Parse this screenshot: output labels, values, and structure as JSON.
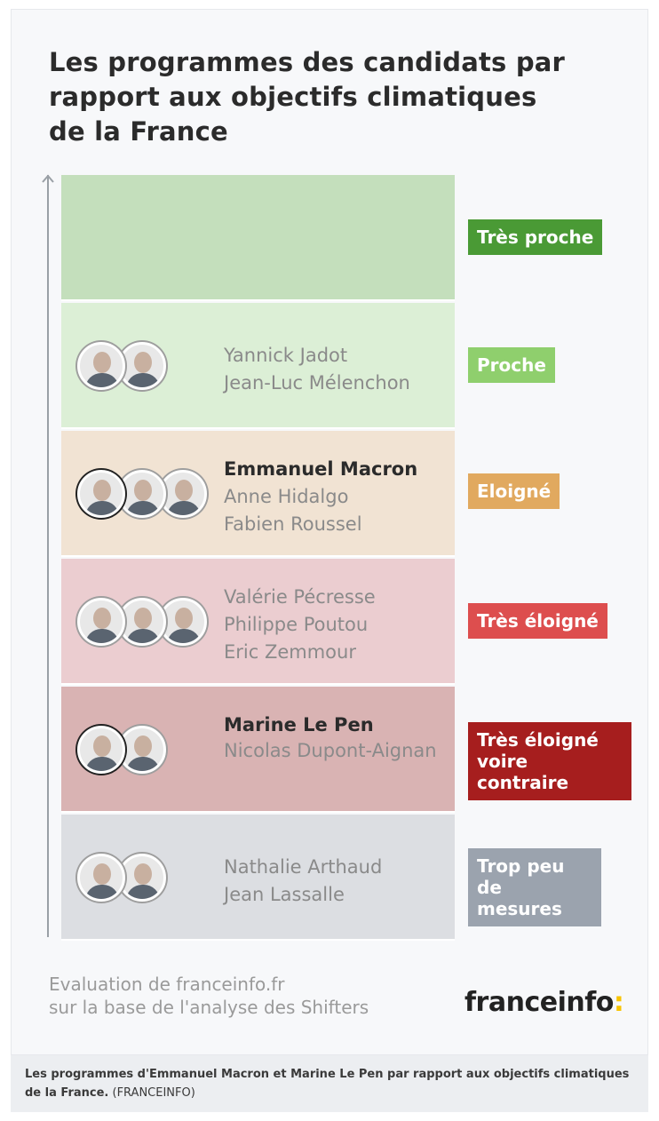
{
  "title": "Les programmes des candidats par rapport aux objectifs climatiques de la France",
  "bands": [
    {
      "label": "Très proche",
      "band_color": "#c4dfbc",
      "label_color": "#4a9a35",
      "candidates": []
    },
    {
      "label": "Proche",
      "band_color": "#dcefd6",
      "label_color": "#8fcf6d",
      "candidates": [
        {
          "name": "Yannick Jadot",
          "highlight": false
        },
        {
          "name": "Jean-Luc Mélenchon",
          "highlight": false
        }
      ]
    },
    {
      "label": "Eloigné",
      "band_color": "#f1e3d3",
      "label_color": "#e1a95f",
      "candidates": [
        {
          "name": "Emmanuel Macron",
          "highlight": true
        },
        {
          "name": "Anne Hidalgo",
          "highlight": false
        },
        {
          "name": "Fabien Roussel",
          "highlight": false
        }
      ]
    },
    {
      "label": "Très éloigné",
      "band_color": "#ebcdd0",
      "label_color": "#dd4e4e",
      "candidates": [
        {
          "name": "Valérie Pécresse",
          "highlight": false
        },
        {
          "name": "Philippe Poutou",
          "highlight": false
        },
        {
          "name": "Eric Zemmour",
          "highlight": false
        }
      ]
    },
    {
      "label": "Très éloigné voire contraire",
      "band_color": "#d9b3b3",
      "label_color": "#a61e1e",
      "candidates": [
        {
          "name": "Marine Le Pen",
          "highlight": true
        },
        {
          "name": "Nicolas Dupont-Aignan",
          "highlight": false
        }
      ]
    },
    {
      "label": "Trop peu de mesures",
      "band_color": "#dcdee2",
      "label_color": "#9ba3ae",
      "candidates": [
        {
          "name": "Nathalie Arthaud",
          "highlight": false
        },
        {
          "name": "Jean Lassalle",
          "highlight": false
        }
      ]
    }
  ],
  "source_line1": "Evaluation de franceinfo.fr",
  "source_line2": "sur la base de l'analyse des Shifters",
  "logo_text": "franceinfo",
  "logo_colon": ":",
  "caption_bold": "Les programmes d'Emmanuel Macron et Marine Le Pen par rapport aux objectifs climatiques de la France.",
  "caption_rest": " (FRANCEINFO)"
}
